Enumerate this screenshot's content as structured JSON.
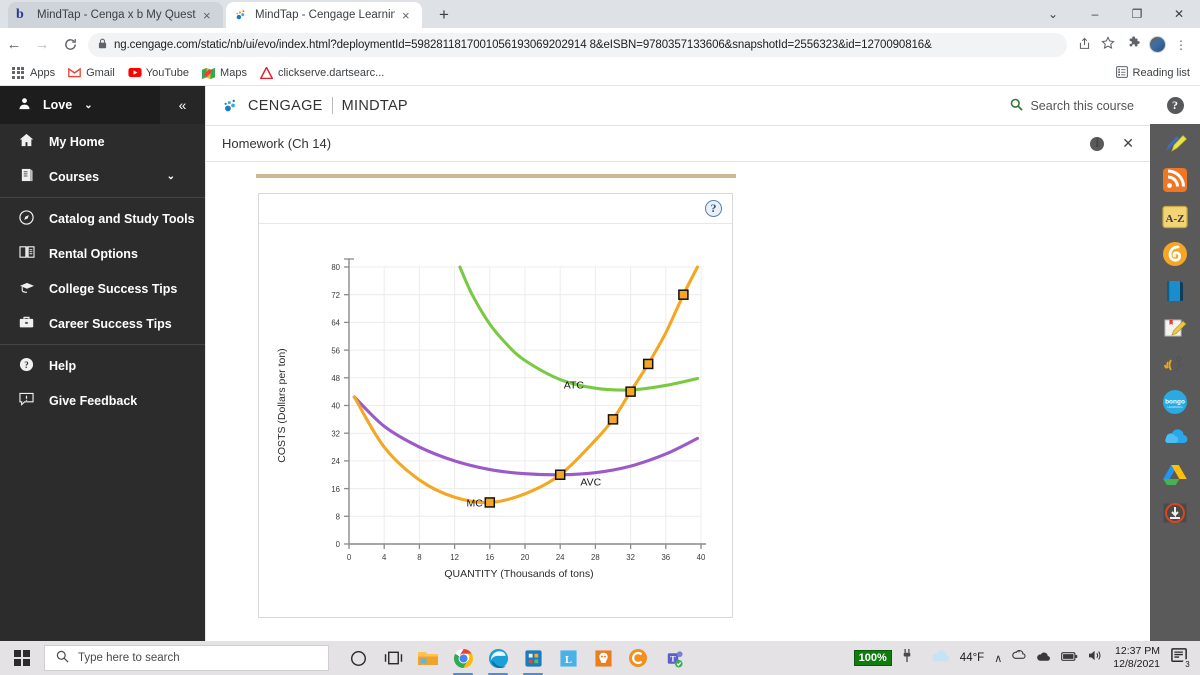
{
  "browser": {
    "tabs": [
      {
        "title": "MindTap - Cenga x b My Questio",
        "favicon": "bing-b-icon",
        "active": false
      },
      {
        "title": "MindTap - Cengage Learning",
        "favicon": "cengage-spark-icon",
        "active": true
      }
    ],
    "new_tab_label": "+",
    "tab_close_label": "×",
    "window_controls": {
      "minimize_group": "⌄",
      "minimize": "‒",
      "restore": "❐",
      "close": "✕"
    },
    "nav": {
      "back": "←",
      "forward": "→",
      "reload": "C"
    },
    "omnibox": {
      "lock_icon": "lock-icon",
      "url": "ng.cengage.com/static/nb/ui/evo/index.html?deploymentId=5982811817001056193069202914 8&eISBN=9780357133606&snapshotId=2556323&id=1270090816&",
      "share_icon": "share-icon",
      "bookmark_icon": "star-icon"
    },
    "toolbar_right": {
      "extensions_icon": "puzzle-icon",
      "profile_icon": "avatar",
      "menu_icon": "kebab-menu-icon"
    },
    "bookmarks": [
      {
        "label": "Apps",
        "icon": "apps-grid-icon"
      },
      {
        "label": "Gmail",
        "icon": "gmail-icon"
      },
      {
        "label": "YouTube",
        "icon": "youtube-icon"
      },
      {
        "label": "Maps",
        "icon": "maps-icon"
      },
      {
        "label": "clickserve.dartsearc...",
        "icon": "adobe-a-icon"
      }
    ],
    "reading_list": {
      "label": "Reading list",
      "icon": "reading-list-icon"
    }
  },
  "left_nav": {
    "user": {
      "label": "Love",
      "avatar_icon": "person-icon",
      "caret": "⌄"
    },
    "collapse_icon": "«",
    "items": [
      {
        "label": "My Home",
        "icon": "home-icon",
        "caret": ""
      },
      {
        "label": "Courses",
        "icon": "book-icon",
        "caret": "⌄"
      },
      {
        "label": "Catalog and Study Tools",
        "icon": "compass-icon",
        "caret": ""
      },
      {
        "label": "Rental Options",
        "icon": "open-book-icon",
        "caret": ""
      },
      {
        "label": "College Success Tips",
        "icon": "graduation-cap-icon",
        "caret": ""
      },
      {
        "label": "Career Success Tips",
        "icon": "briefcase-icon",
        "caret": ""
      },
      {
        "label": "Help",
        "icon": "question-circle-icon",
        "caret": ""
      },
      {
        "label": "Give Feedback",
        "icon": "feedback-icon",
        "caret": ""
      }
    ]
  },
  "mindtap": {
    "brand": {
      "cengage": "CENGAGE",
      "mindtap": "MINDTAP",
      "logo_icon": "cengage-spark-icon"
    },
    "search": {
      "label": "Search this course",
      "icon": "search-icon"
    },
    "activity": {
      "title": "Homework (Ch 14)",
      "info_icon": "info-icon",
      "close_icon": "close-icon"
    },
    "question_box": {
      "help_label": "?"
    }
  },
  "right_rail": {
    "help_label": "?",
    "icons": [
      {
        "name": "highlighter-pen-icon"
      },
      {
        "name": "rss-feed-icon"
      },
      {
        "name": "a-z-glossary-icon",
        "label": "A-Z"
      },
      {
        "name": "brainhoney-icon"
      },
      {
        "name": "ebook-icon"
      },
      {
        "name": "notepad-pencil-icon"
      },
      {
        "name": "read-aloud-icon"
      },
      {
        "name": "bongo-icon",
        "label": "bongo"
      },
      {
        "name": "onedrive-cloud-icon"
      },
      {
        "name": "google-drive-icon"
      },
      {
        "name": "flashcards-icon"
      }
    ]
  },
  "scrollbar": {
    "up_arrow": "▲",
    "down_arrow": "▼"
  },
  "taskbar": {
    "start_icon": "windows-logo-icon",
    "search": {
      "placeholder": "Type here to search",
      "icon": "magnifier-icon"
    },
    "items": [
      {
        "name": "cortana-icon"
      },
      {
        "name": "task-view-icon"
      },
      {
        "name": "file-explorer-icon"
      },
      {
        "name": "google-chrome-icon",
        "running": true
      },
      {
        "name": "microsoft-edge-icon",
        "running": true
      },
      {
        "name": "microsoft-store-icon",
        "running": true
      },
      {
        "name": "lastpass-icon"
      },
      {
        "name": "mcafee-icon"
      },
      {
        "name": "cengage-c-icon"
      },
      {
        "name": "microsoft-teams-icon"
      }
    ],
    "tray": {
      "battery_percent": "100%",
      "plug_icon": "power-plug-icon",
      "weather": {
        "temp": "44°F",
        "icon": "cloud-icon"
      },
      "chevron": "∧",
      "onedrive_icon": "onedrive-icon",
      "cloud_icon": "cloud-sync-icon",
      "battery_icon": "battery-icon",
      "volume_icon": "speaker-icon",
      "time": "12:37 PM",
      "date": "12/8/2021",
      "notifications": {
        "icon": "notification-icon",
        "count": "3"
      }
    }
  },
  "chart_data": {
    "type": "line",
    "title": "",
    "xlabel": "QUANTITY (Thousands of tons)",
    "ylabel": "COSTS (Dollars per ton)",
    "xlim": [
      0,
      40
    ],
    "ylim": [
      0,
      80
    ],
    "xticks": [
      0,
      4,
      8,
      12,
      16,
      20,
      24,
      28,
      32,
      36,
      40
    ],
    "yticks": [
      0,
      8,
      16,
      24,
      32,
      40,
      48,
      56,
      64,
      72,
      80
    ],
    "grid": true,
    "legend_position": "inline-annotations",
    "series": [
      {
        "name": "MC",
        "label": "MC",
        "color": "#f5a623",
        "annotation": {
          "x": 16,
          "y": 12,
          "text": "MC",
          "side": "left"
        },
        "markers": [
          {
            "x": 16,
            "y": 12
          },
          {
            "x": 24,
            "y": 20
          },
          {
            "x": 30,
            "y": 36
          },
          {
            "x": 32,
            "y": 44
          },
          {
            "x": 34,
            "y": 52
          },
          {
            "x": 38,
            "y": 72
          }
        ],
        "points": [
          {
            "x": 0.6,
            "y": 42.5
          },
          {
            "x": 4,
            "y": 28
          },
          {
            "x": 8,
            "y": 18.5
          },
          {
            "x": 12,
            "y": 13.5
          },
          {
            "x": 16,
            "y": 12
          },
          {
            "x": 20,
            "y": 14.5
          },
          {
            "x": 24,
            "y": 20
          },
          {
            "x": 28,
            "y": 30
          },
          {
            "x": 30,
            "y": 36
          },
          {
            "x": 32,
            "y": 44
          },
          {
            "x": 34,
            "y": 52
          },
          {
            "x": 36,
            "y": 61
          },
          {
            "x": 38,
            "y": 72
          },
          {
            "x": 39.6,
            "y": 80
          }
        ]
      },
      {
        "name": "AVC",
        "label": "AVC",
        "color": "#9b59c9",
        "annotation": {
          "x": 25.5,
          "y": 18,
          "text": "AVC",
          "side": "right"
        },
        "markers": [],
        "points": [
          {
            "x": 0.6,
            "y": 42.5
          },
          {
            "x": 4,
            "y": 34
          },
          {
            "x": 8,
            "y": 28
          },
          {
            "x": 12,
            "y": 24
          },
          {
            "x": 16,
            "y": 21.5
          },
          {
            "x": 20,
            "y": 20.3
          },
          {
            "x": 24,
            "y": 20
          },
          {
            "x": 28,
            "y": 20.6
          },
          {
            "x": 32,
            "y": 22.5
          },
          {
            "x": 36,
            "y": 26
          },
          {
            "x": 39.6,
            "y": 30.5
          }
        ]
      },
      {
        "name": "ATC",
        "label": "ATC",
        "color": "#7ac943",
        "annotation": {
          "x": 27.5,
          "y": 46,
          "text": "ATC",
          "side": "left"
        },
        "markers": [],
        "points": [
          {
            "x": 12.6,
            "y": 80
          },
          {
            "x": 14,
            "y": 72
          },
          {
            "x": 16,
            "y": 63.5
          },
          {
            "x": 18,
            "y": 57.5
          },
          {
            "x": 20,
            "y": 53
          },
          {
            "x": 24,
            "y": 47.5
          },
          {
            "x": 28,
            "y": 45
          },
          {
            "x": 32,
            "y": 44.5
          },
          {
            "x": 36,
            "y": 45.8
          },
          {
            "x": 39.6,
            "y": 47.8
          }
        ]
      }
    ]
  }
}
